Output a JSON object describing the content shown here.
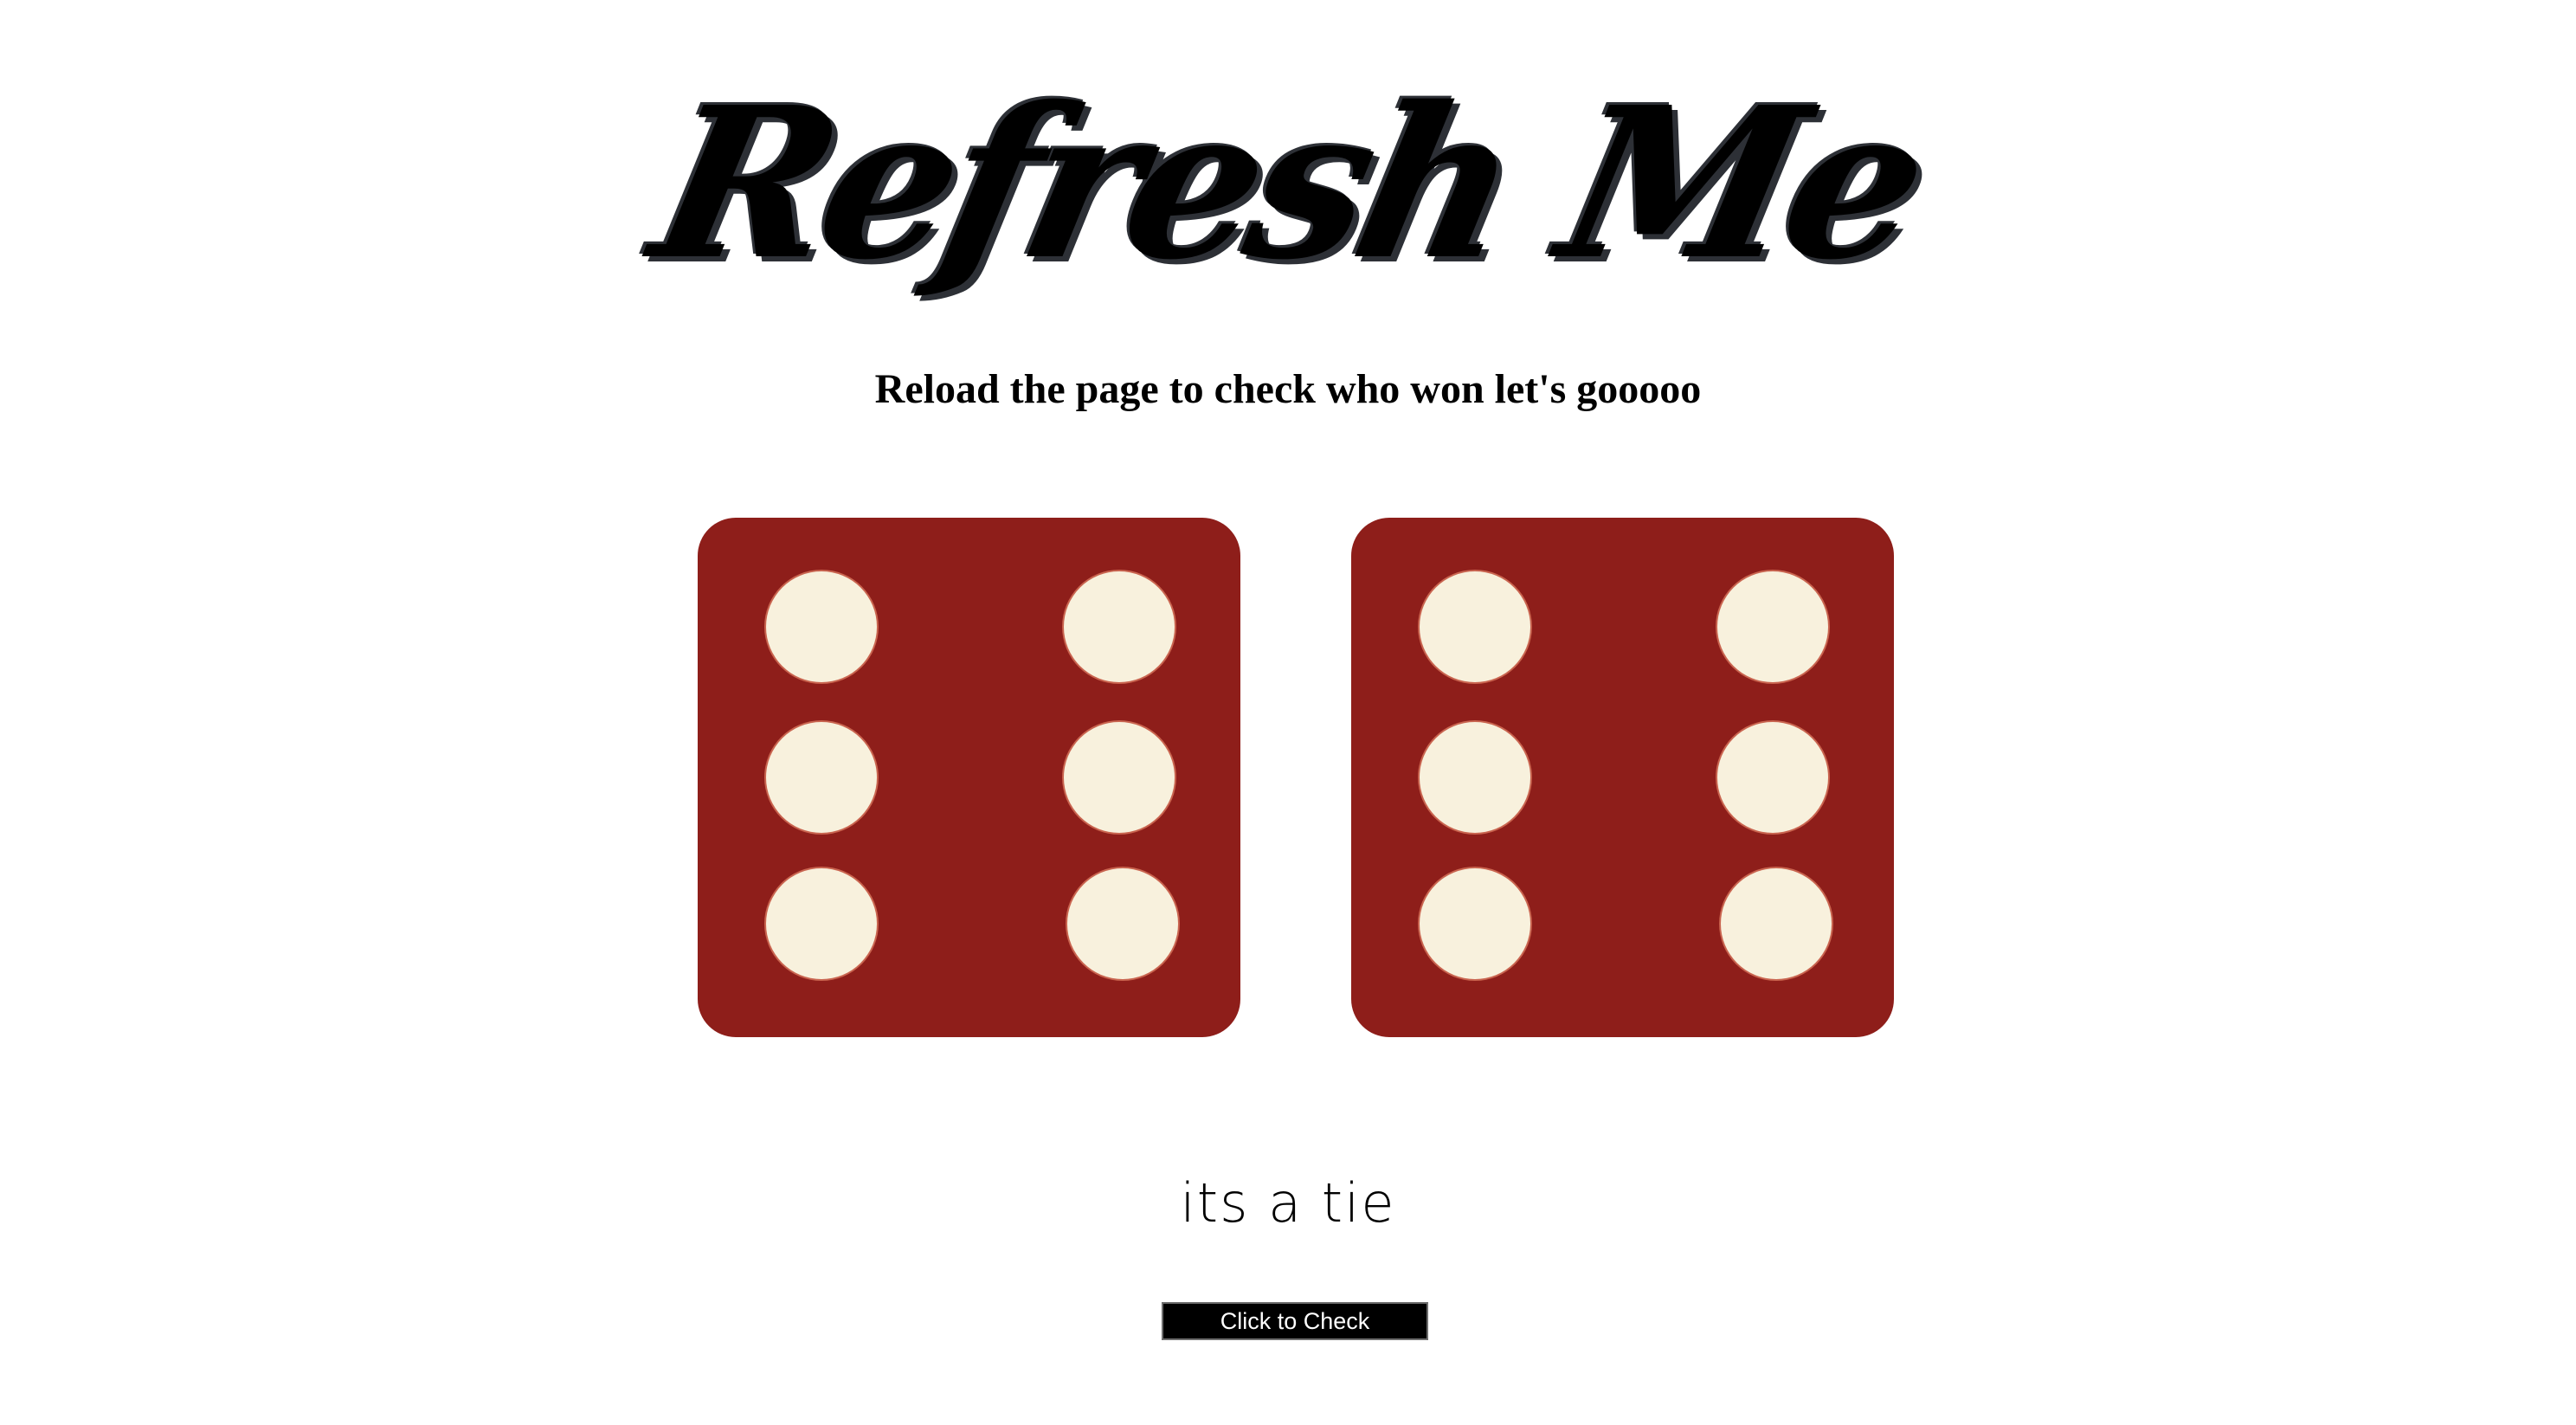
{
  "header": {
    "title": "Refresh Me",
    "subtitle": "Reload the page to check who won let's gooooo"
  },
  "dice": {
    "player1": {
      "value": 6,
      "pip_icon": "pip-icon"
    },
    "player2": {
      "value": 6,
      "pip_icon": "pip-icon"
    },
    "colors": {
      "die": "#8e1e1a",
      "pip": "#f8f1dd"
    }
  },
  "result": {
    "text": "its a tie"
  },
  "actions": {
    "check_label": "Click to Check"
  }
}
